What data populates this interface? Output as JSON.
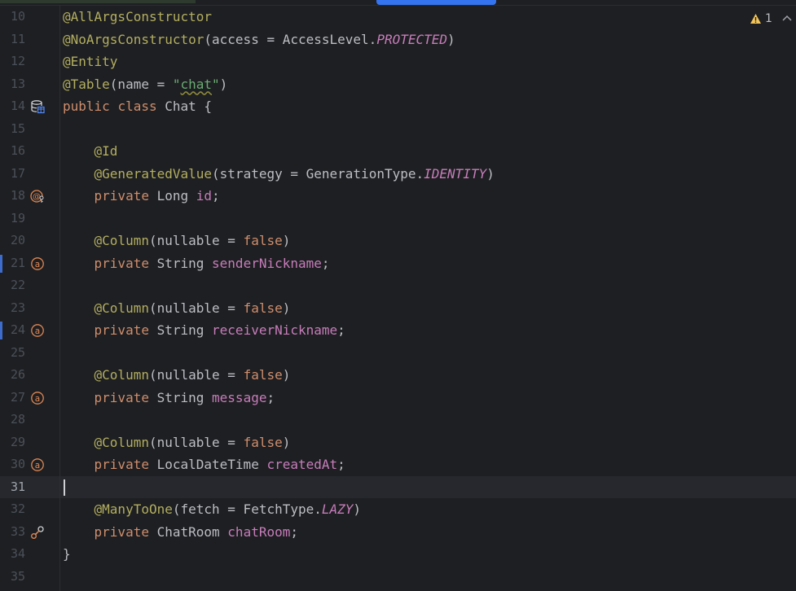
{
  "editor": {
    "status": {
      "warning_count": "1"
    },
    "lines": [
      {
        "num": "10",
        "tokens": [
          {
            "t": "@AllArgsConstructor",
            "c": "ann"
          }
        ]
      },
      {
        "num": "11",
        "tokens": [
          {
            "t": "@NoArgsConstructor",
            "c": "ann"
          },
          {
            "t": "(access = AccessLevel."
          },
          {
            "t": "PROTECTED",
            "c": "ital"
          },
          {
            "t": ")"
          }
        ]
      },
      {
        "num": "12",
        "tokens": [
          {
            "t": "@Entity",
            "c": "ann"
          }
        ]
      },
      {
        "num": "13",
        "tokens": [
          {
            "t": "@Table",
            "c": "ann"
          },
          {
            "t": "(name = "
          },
          {
            "t": "\"",
            "c": "str"
          },
          {
            "t": "chat",
            "c": "str sq"
          },
          {
            "t": "\"",
            "c": "str"
          },
          {
            "t": ")"
          }
        ]
      },
      {
        "num": "14",
        "gutter_icon": "database-table-icon",
        "tokens": [
          {
            "t": "public ",
            "c": "kw"
          },
          {
            "t": "class ",
            "c": "kw"
          },
          {
            "t": "Chat {"
          }
        ]
      },
      {
        "num": "15",
        "tokens": []
      },
      {
        "num": "16",
        "tokens": [
          {
            "t": "    "
          },
          {
            "t": "@Id",
            "c": "ann"
          }
        ]
      },
      {
        "num": "17",
        "tokens": [
          {
            "t": "    "
          },
          {
            "t": "@GeneratedValue",
            "c": "ann"
          },
          {
            "t": "(strategy = GenerationType."
          },
          {
            "t": "IDENTITY",
            "c": "ital"
          },
          {
            "t": ")"
          }
        ]
      },
      {
        "num": "18",
        "gutter_icon": "id-field-icon",
        "tokens": [
          {
            "t": "    "
          },
          {
            "t": "private ",
            "c": "kw"
          },
          {
            "t": "Long "
          },
          {
            "t": "id",
            "c": "fld"
          },
          {
            "t": ";"
          }
        ]
      },
      {
        "num": "19",
        "tokens": []
      },
      {
        "num": "20",
        "tokens": [
          {
            "t": "    "
          },
          {
            "t": "@Column",
            "c": "ann"
          },
          {
            "t": "(nullable = "
          },
          {
            "t": "false",
            "c": "kw"
          },
          {
            "t": ")"
          }
        ]
      },
      {
        "num": "21",
        "vcs": true,
        "gutter_icon": "column-field-icon",
        "tokens": [
          {
            "t": "    "
          },
          {
            "t": "private ",
            "c": "kw"
          },
          {
            "t": "String "
          },
          {
            "t": "senderNickname",
            "c": "fld"
          },
          {
            "t": ";"
          }
        ]
      },
      {
        "num": "22",
        "tokens": []
      },
      {
        "num": "23",
        "tokens": [
          {
            "t": "    "
          },
          {
            "t": "@Column",
            "c": "ann"
          },
          {
            "t": "(nullable = "
          },
          {
            "t": "false",
            "c": "kw"
          },
          {
            "t": ")"
          }
        ]
      },
      {
        "num": "24",
        "vcs": true,
        "gutter_icon": "column-field-icon",
        "tokens": [
          {
            "t": "    "
          },
          {
            "t": "private ",
            "c": "kw"
          },
          {
            "t": "String "
          },
          {
            "t": "receiverNickname",
            "c": "fld"
          },
          {
            "t": ";"
          }
        ]
      },
      {
        "num": "25",
        "tokens": []
      },
      {
        "num": "26",
        "tokens": [
          {
            "t": "    "
          },
          {
            "t": "@Column",
            "c": "ann"
          },
          {
            "t": "(nullable = "
          },
          {
            "t": "false",
            "c": "kw"
          },
          {
            "t": ")"
          }
        ]
      },
      {
        "num": "27",
        "gutter_icon": "column-field-icon",
        "tokens": [
          {
            "t": "    "
          },
          {
            "t": "private ",
            "c": "kw"
          },
          {
            "t": "String "
          },
          {
            "t": "message",
            "c": "fld"
          },
          {
            "t": ";"
          }
        ]
      },
      {
        "num": "28",
        "tokens": []
      },
      {
        "num": "29",
        "tokens": [
          {
            "t": "    "
          },
          {
            "t": "@Column",
            "c": "ann"
          },
          {
            "t": "(nullable = "
          },
          {
            "t": "false",
            "c": "kw"
          },
          {
            "t": ")"
          }
        ]
      },
      {
        "num": "30",
        "gutter_icon": "column-field-icon",
        "tokens": [
          {
            "t": "    "
          },
          {
            "t": "private ",
            "c": "kw"
          },
          {
            "t": "LocalDateTime "
          },
          {
            "t": "createdAt",
            "c": "fld"
          },
          {
            "t": ";"
          }
        ]
      },
      {
        "num": "31",
        "current": true,
        "tokens": []
      },
      {
        "num": "32",
        "tokens": [
          {
            "t": "    "
          },
          {
            "t": "@ManyToOne",
            "c": "ann"
          },
          {
            "t": "(fetch = FetchType."
          },
          {
            "t": "LAZY",
            "c": "ital"
          },
          {
            "t": ")"
          }
        ]
      },
      {
        "num": "33",
        "gutter_icon": "relation-field-icon",
        "tokens": [
          {
            "t": "    "
          },
          {
            "t": "private ",
            "c": "kw"
          },
          {
            "t": "ChatRoom "
          },
          {
            "t": "chatRoom",
            "c": "fld"
          },
          {
            "t": ";"
          }
        ]
      },
      {
        "num": "34",
        "tokens": [
          {
            "t": "}"
          }
        ]
      },
      {
        "num": "35",
        "tokens": []
      }
    ]
  }
}
